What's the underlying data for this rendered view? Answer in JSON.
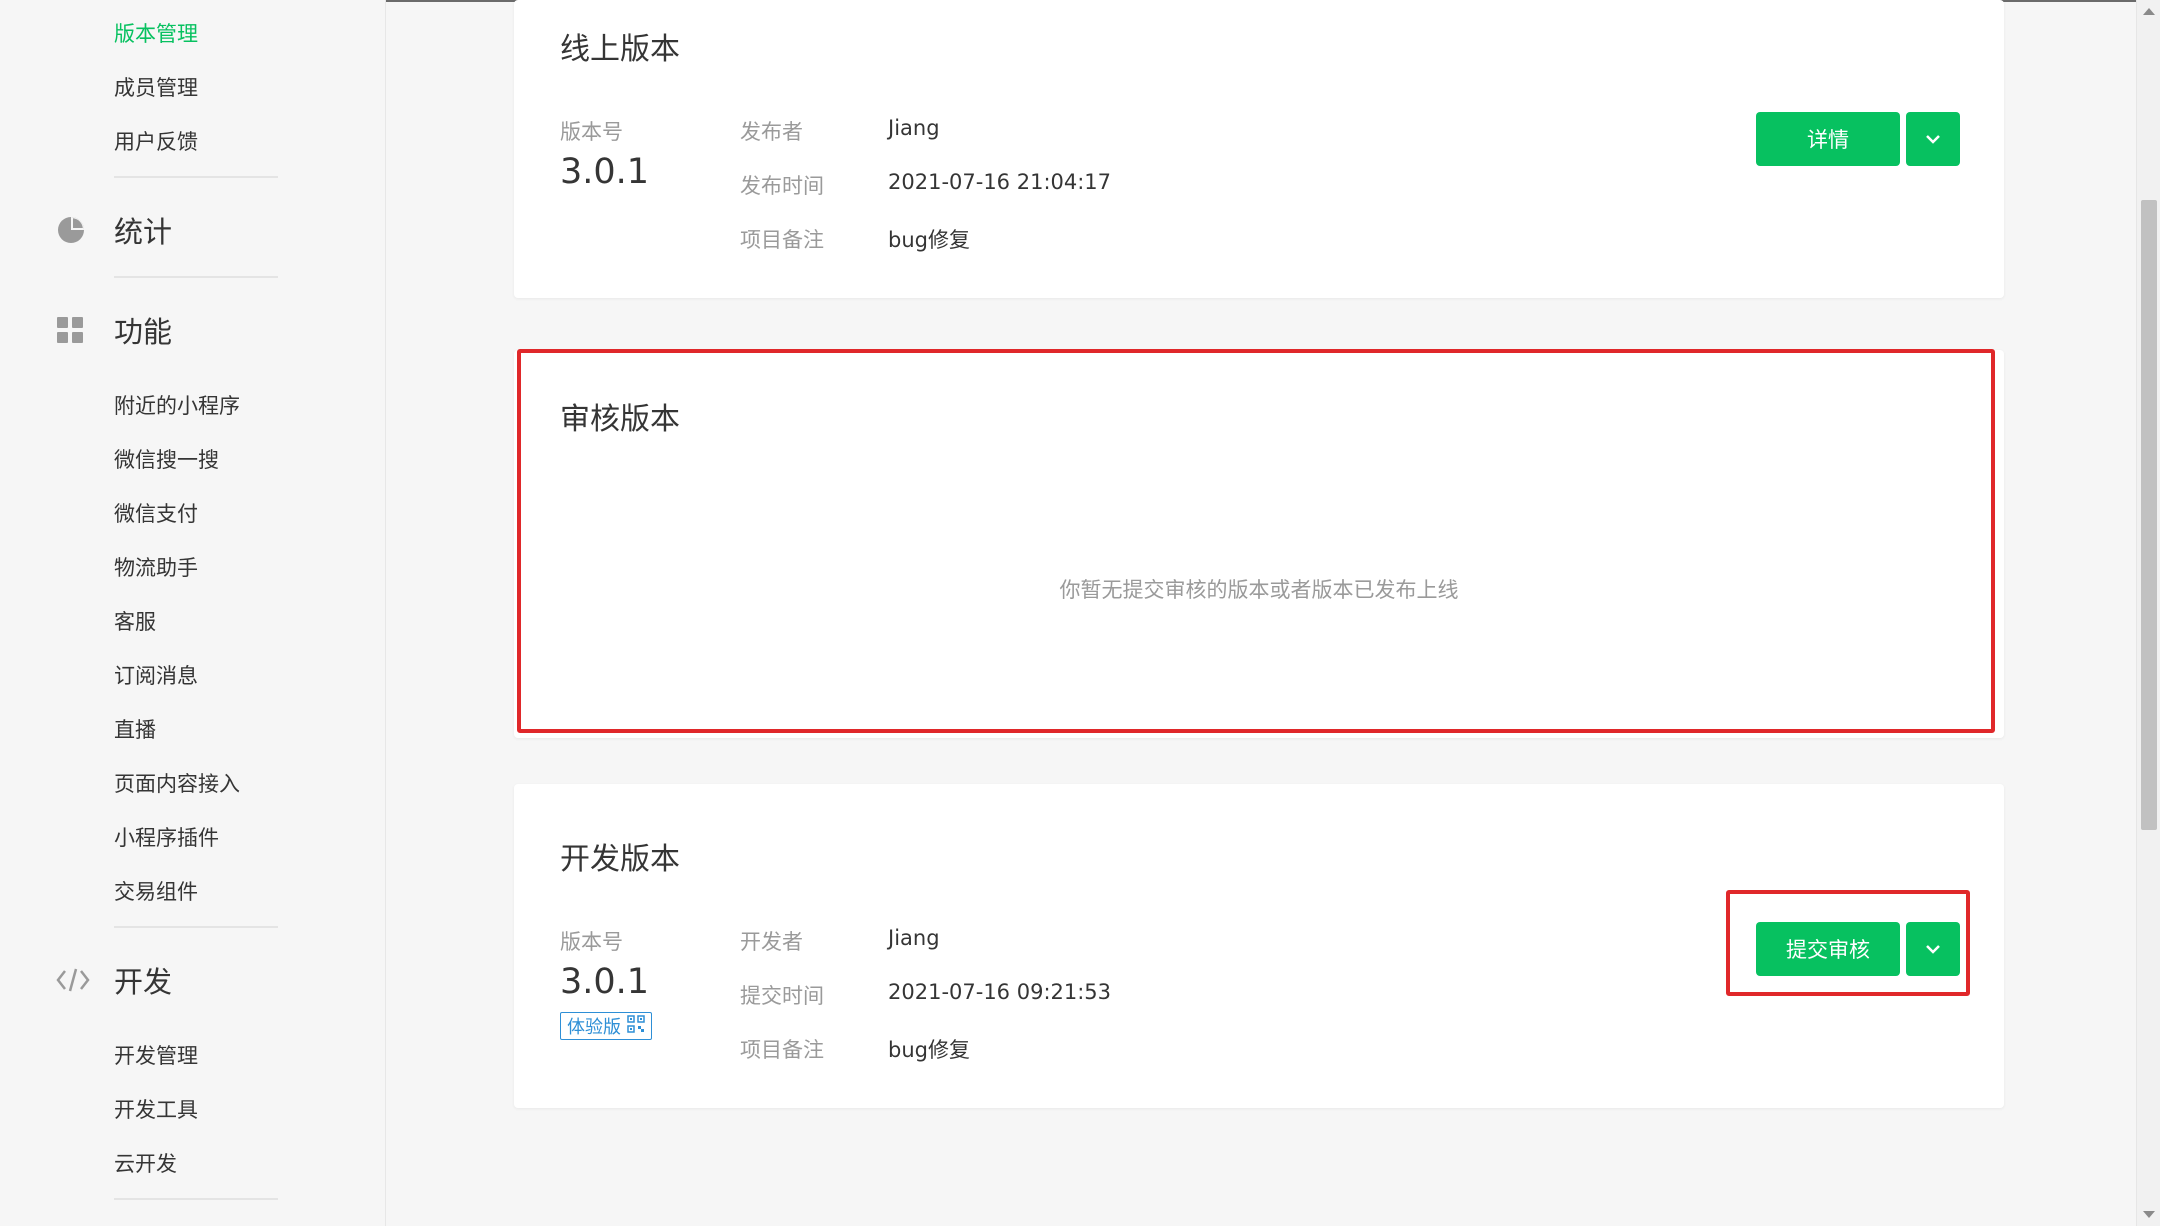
{
  "sidebar": {
    "top_items": [
      "版本管理",
      "成员管理",
      "用户反馈"
    ],
    "sections": [
      {
        "label": "统计",
        "icon": "pie-chart-icon"
      },
      {
        "label": "功能",
        "icon": "grid-icon"
      },
      {
        "label": "开发",
        "icon": "code-icon"
      }
    ],
    "function_items": [
      "附近的小程序",
      "微信搜一搜",
      "微信支付",
      "物流助手",
      "客服",
      "订阅消息",
      "直播",
      "页面内容接入",
      "小程序插件",
      "交易组件"
    ],
    "dev_items": [
      "开发管理",
      "开发工具",
      "云开发"
    ]
  },
  "online": {
    "title": "线上版本",
    "version_label": "版本号",
    "version": "3.0.1",
    "publisher_label": "发布者",
    "publisher": "Jiang",
    "time_label": "发布时间",
    "time": "2021-07-16 21:04:17",
    "note_label": "项目备注",
    "note": "bug修复",
    "detail_button": "详情"
  },
  "review": {
    "title": "审核版本",
    "empty_text": "你暂无提交审核的版本或者版本已发布上线"
  },
  "dev": {
    "title": "开发版本",
    "version_label": "版本号",
    "version": "3.0.1",
    "trial_tag": "体验版",
    "developer_label": "开发者",
    "developer": "Jiang",
    "time_label": "提交时间",
    "time": "2021-07-16 09:21:53",
    "note_label": "项目备注",
    "note": "bug修复",
    "submit_button": "提交审核"
  },
  "colors": {
    "accent": "#07c160",
    "highlight": "#e0282a",
    "tag_blue": "#2e8fd6"
  }
}
